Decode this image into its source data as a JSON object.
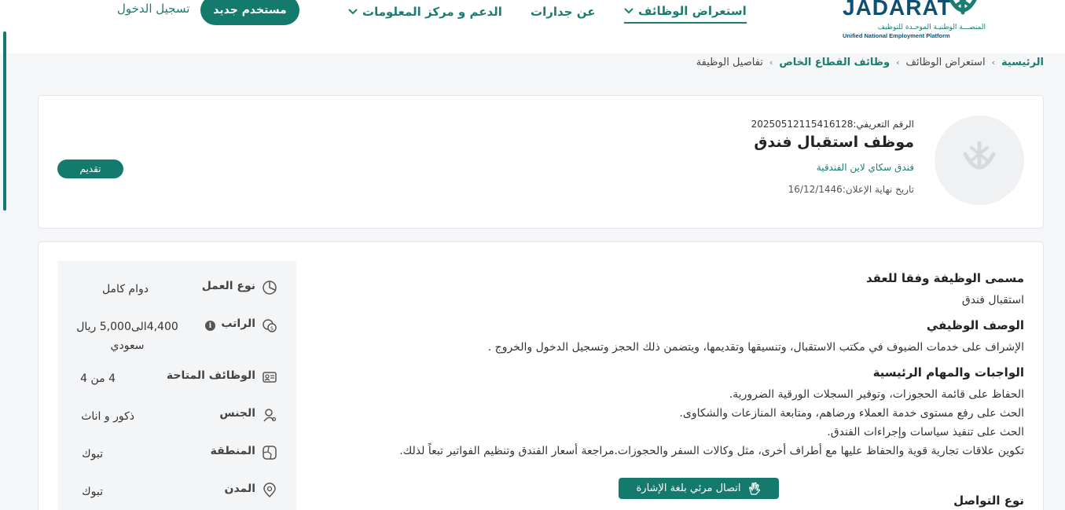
{
  "header": {
    "logo_text": "JADARAT",
    "logo_ar": "المنصـــة الوطنيـة الموحـدة للتوظيف",
    "logo_en": "Unified National Employment Platform",
    "nav": [
      {
        "label": "استعراض الوظائف",
        "active": true,
        "dropdown": true
      },
      {
        "label": "عن جدارات",
        "active": false,
        "dropdown": false
      },
      {
        "label": "الدعم و مركز المعلومات",
        "active": false,
        "dropdown": true
      }
    ],
    "new_user_label": "مستخدم جديد",
    "login_label": "تسجيل الدخول"
  },
  "breadcrumb": [
    {
      "label": "الرئيسية",
      "link": true
    },
    {
      "label": "استعراض الوظائف",
      "link": false
    },
    {
      "label": "وظائف القطاع الخاص",
      "link": true
    },
    {
      "label": "تفاصيل الوظيفة",
      "link": false
    }
  ],
  "job": {
    "reference": "الرقم التعريفي:20250512115416128",
    "title": "موظف استقبال فندق",
    "company": "فندق سكاي لاين الفندقية",
    "deadline": "تاريخ نهاية الإعلان:16/12/1446",
    "apply_label": "تقديم"
  },
  "details": {
    "sections": [
      {
        "title": "مسمى الوظيفة وفقا للعقد",
        "lines": [
          "استقبال فندق"
        ]
      },
      {
        "title": "الوصف الوظيفي",
        "lines": [
          "الإشراف على خدمات الضيوف في مكتب الاستقبال، وتنسيقها وتقديمها، ويتضمن ذلك الحجز وتسجيل الدخول والخروج ."
        ]
      },
      {
        "title": "الواجبات والمهام الرئيسية",
        "lines": [
          "الحفاظ على قائمة الحجوزات، وتوفير السجلات الورقية الضرورية.",
          "الحث على رفع مستوى خدمة العملاء ورضاهم، ومتابعة المنازعات والشكاوى.",
          "الحث على تنفيذ سياسات وإجراءات الفندق.",
          "تكوين علاقات تجارية قوية والحفاظ عليها مع أطراف أخرى، مثل وكالات السفر والحجوزات.مراجعة أسعار الفندق وتنظيم الفواتير تبعاً لذلك."
        ]
      }
    ],
    "sign_language_label": "اتصال مرئي بلغة الإشارة",
    "next_section_title": "نوع التواصل"
  },
  "info": [
    {
      "icon": "pie-chart-icon",
      "label": "نوع العمل",
      "value": "دوام كامل"
    },
    {
      "icon": "salary-icon",
      "label": "الراتب",
      "value": "4,400الى5,000 ريال سعودي",
      "badge": "i"
    },
    {
      "icon": "id-card-icon",
      "label": "الوظائف المتاحة",
      "value": "4  من 4"
    },
    {
      "icon": "gender-icon",
      "label": "الجنس",
      "value": "ذكور و اناث"
    },
    {
      "icon": "map-icon",
      "label": "المنطقة",
      "value": "تبوك"
    },
    {
      "icon": "location-pin-icon",
      "label": "المدن",
      "value": "تبوك"
    }
  ],
  "colors": {
    "accent": "#157a6e",
    "brand_blue": "#0e4f72",
    "page_bg": "#f5f6f8"
  }
}
